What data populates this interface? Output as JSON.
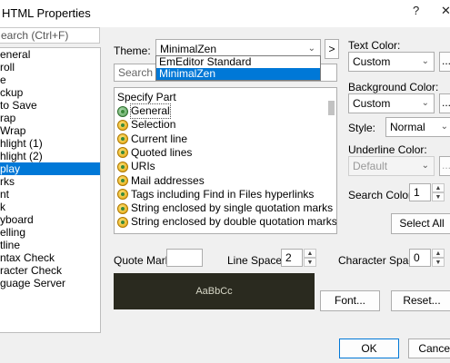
{
  "window": {
    "title": "HTML Properties",
    "help_label": "?",
    "close_label": "✕"
  },
  "search": {
    "placeholder": "earch (Ctrl+F)"
  },
  "categories": [
    {
      "label": "eneral",
      "selected": false
    },
    {
      "label": "roll",
      "selected": false
    },
    {
      "label": "e",
      "selected": false
    },
    {
      "label": "ckup",
      "selected": false
    },
    {
      "label": "to Save",
      "selected": false
    },
    {
      "label": "rap",
      "selected": false
    },
    {
      "label": " Wrap",
      "selected": false
    },
    {
      "label": "hlight (1)",
      "selected": false
    },
    {
      "label": "hlight (2)",
      "selected": false
    },
    {
      "label": "play",
      "selected": true
    },
    {
      "label": "rks",
      "selected": false
    },
    {
      "label": "nt",
      "selected": false
    },
    {
      "label": "k",
      "selected": false
    },
    {
      "label": "yboard",
      "selected": false
    },
    {
      "label": "elling",
      "selected": false
    },
    {
      "label": "tline",
      "selected": false
    },
    {
      "label": "ntax Check",
      "selected": false
    },
    {
      "label": "racter Check",
      "selected": false
    },
    {
      "label": "guage Server",
      "selected": false
    }
  ],
  "theme": {
    "label": "Theme:",
    "value": "MinimalZen",
    "next_button": ">",
    "options": [
      {
        "label": "EmEditor Standard",
        "selected": false
      },
      {
        "label": "MinimalZen",
        "selected": true
      }
    ]
  },
  "part_search": {
    "placeholder": "Search"
  },
  "parts": {
    "header": "Specify Part",
    "items": [
      {
        "label": "General",
        "icon": "general-part-icon"
      },
      {
        "label": "Selection",
        "icon": "part-icon"
      },
      {
        "label": "Current line",
        "icon": "part-icon"
      },
      {
        "label": "Quoted lines",
        "icon": "part-icon"
      },
      {
        "label": "URIs",
        "icon": "part-icon"
      },
      {
        "label": "Mail addresses",
        "icon": "part-icon"
      },
      {
        "label": "Tags including Find in Files hyperlinks",
        "icon": "part-icon"
      },
      {
        "label": "String enclosed by single quotation marks '...'",
        "icon": "part-icon"
      },
      {
        "label": "String enclosed by double quotation marks \"...\"",
        "icon": "part-icon"
      }
    ]
  },
  "text_color": {
    "label": "Text Color:",
    "value": "Custom",
    "more": "..."
  },
  "background_color": {
    "label": "Background Color:",
    "value": "Custom",
    "more": "..."
  },
  "style": {
    "label": "Style:",
    "value": "Normal"
  },
  "underline_color": {
    "label": "Underline Color:",
    "value": "Default",
    "more": "..."
  },
  "search_colors": {
    "label": "Search Colors:",
    "value": "1"
  },
  "select_all_button": "Select All",
  "quote_marks": {
    "label": "Quote Marks:",
    "value": ""
  },
  "line_space": {
    "label": "Line Space:",
    "value": "2"
  },
  "character_space": {
    "label": "Character Space:",
    "value": "0"
  },
  "preview_text": "AaBbCc",
  "font_button": "Font...",
  "reset_button": "Reset...",
  "ok_button": "OK",
  "cancel_button": "Cancel",
  "colors": {
    "selection": "#0078d7",
    "preview_bg": "#2a2a1f"
  }
}
